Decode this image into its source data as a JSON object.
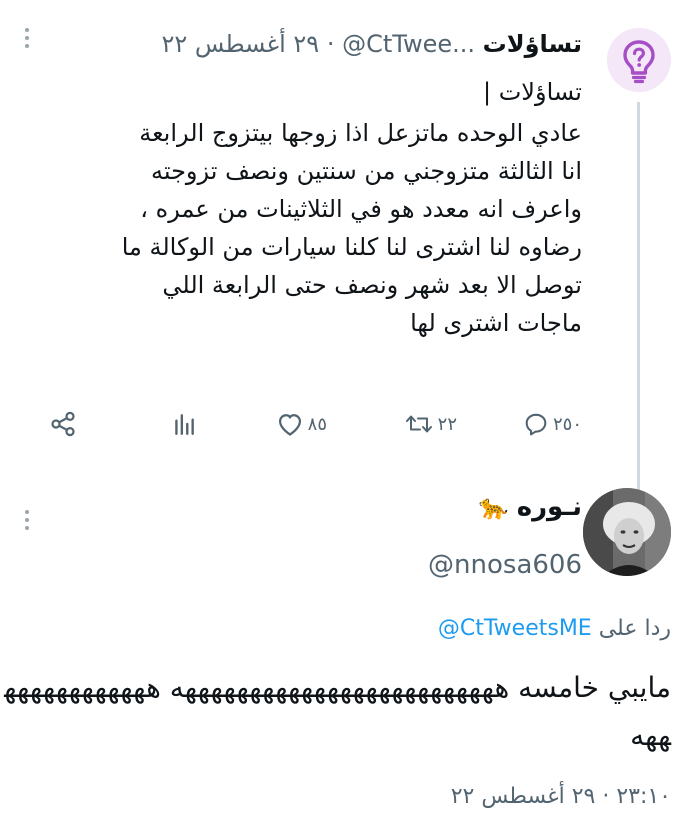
{
  "tweet1": {
    "display_name": "تساؤلات",
    "handle": "@CtTwee...",
    "separator": "·",
    "date": "٢٩ أغسطس ٢٢",
    "prefix": "تساؤلات |",
    "body": "عادي الوحده ماتزعل اذا زوجها بيتزوج الرابعة انا الثالثة متزوجني من سنتين ونصف تزوجته واعرف انه معدد هو في الثلاثينات من عمره ، رضاوه لنا اشترى لنا كلنا سيارات من الوكالة ما توصل الا بعد شهر ونصف حتى الرابعة اللي ماجات اشترى لها",
    "avatar_icon": "question-lightbulb-icon",
    "stats": {
      "replies": "٢٥٠",
      "retweets": "٢٢",
      "likes": "٨٥"
    }
  },
  "tweet2": {
    "display_name": "نـوره",
    "emoji": "🐆",
    "handle": "@nnosa606",
    "replying_label": "ردا على",
    "replying_handle": "@CtTweetsME",
    "body": "مايبي خامسه هههههههههههههههههههههههههه ههههههههههههههه",
    "timestamp": "٢٣:١٠ · ٢٩ أغسطس ٢٢"
  },
  "colors": {
    "muted": "#536471",
    "link": "#1d9bf0",
    "accent": "#a64ec6",
    "line": "#cfd9de"
  }
}
